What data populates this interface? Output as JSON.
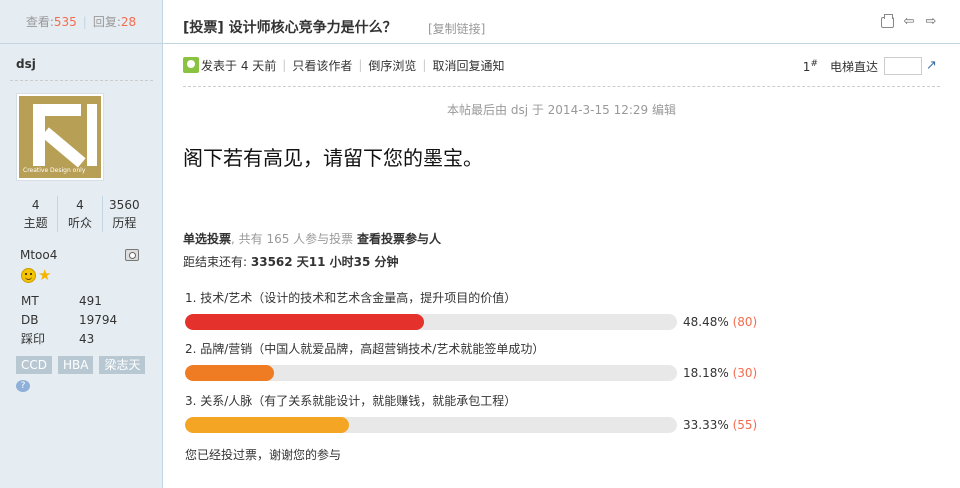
{
  "left": {
    "views_label": "查看:",
    "views": "535",
    "replies_label": "回复:",
    "replies": "28",
    "username": "dsj",
    "avatar_text": "Creative Design only",
    "counts": [
      {
        "value": "4",
        "label": "主题"
      },
      {
        "value": "4",
        "label": "听众"
      },
      {
        "value": "3560",
        "label": "历程"
      }
    ],
    "group": "Mtoo4",
    "profile": [
      {
        "key": "MT",
        "value": "491"
      },
      {
        "key": "DB",
        "value": "19794"
      },
      {
        "key": "踩印",
        "value": "43"
      }
    ],
    "tags": [
      "CCD",
      "HBA",
      "梁志天"
    ]
  },
  "header": {
    "title": "[投票] 设计师核心竞争力是什么？",
    "copy_link": "[复制链接]"
  },
  "meta": {
    "posted": "发表于 4 天前",
    "only_author": "只看该作者",
    "reverse": "倒序浏览",
    "cancel_notify": "取消回复通知",
    "floor": "1",
    "floor_suffix": "#",
    "jump_label": "电梯直达"
  },
  "edit_note": "本帖最后由 dsj 于 2014-3-15 12:29 编辑",
  "post": {
    "body": "阁下若有高见，请留下您的墨宝。"
  },
  "poll": {
    "type_label": "单选投票",
    "participants_text": ", 共有 165 人参与投票",
    "view_voters": "查看投票参与人",
    "remaining_label": "距结束还有:",
    "remaining_value": "33562 天11 小时35 分钟",
    "options": [
      {
        "label": "1. 技术/艺术（设计的技术和艺术含金量高，提升项目的价值）",
        "percent": 48.48,
        "percent_text": "48.48%",
        "count_text": "(80)",
        "color": "#e4312b"
      },
      {
        "label": "2. 品牌/营销（中国人就爱品牌，高超营销技术/艺术就能签单成功）",
        "percent": 18.18,
        "percent_text": "18.18%",
        "count_text": "(30)",
        "color": "#ef7b22"
      },
      {
        "label": "3. 关系/人脉（有了关系就能设计，就能赚钱，就能承包工程）",
        "percent": 33.33,
        "percent_text": "33.33%",
        "count_text": "(55)",
        "color": "#f3a523"
      }
    ],
    "done_text": "您已经投过票，谢谢您的参与"
  }
}
